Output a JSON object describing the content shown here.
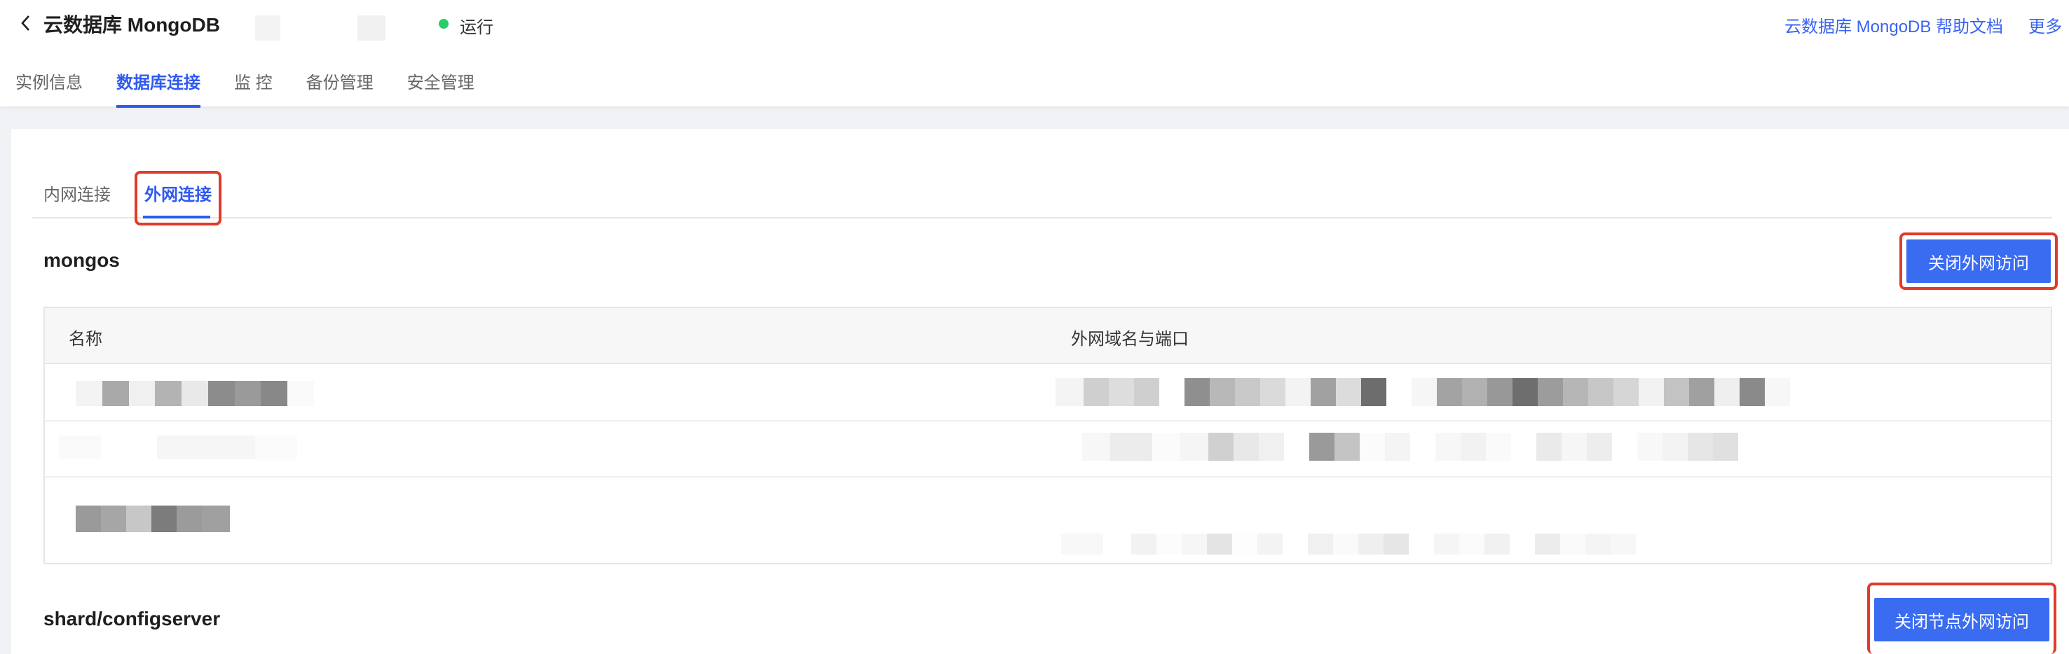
{
  "header": {
    "title": "云数据库 MongoDB",
    "status": "运行",
    "status_color": "#29cc6a",
    "help_link": "云数据库 MongoDB 帮助文档",
    "more_link": "更多",
    "back_icon": "chevron-left-icon"
  },
  "nav": {
    "tabs": [
      {
        "label": "实例信息",
        "active": false
      },
      {
        "label": "数据库连接",
        "active": true
      },
      {
        "label": "监 控",
        "active": false
      },
      {
        "label": "备份管理",
        "active": false
      },
      {
        "label": "安全管理",
        "active": false
      }
    ]
  },
  "connection_tabs": {
    "inner": "内网连接",
    "outer": "外网连接",
    "active": "外网连接"
  },
  "mongos": {
    "title": "mongos",
    "close_button": "关闭外网访问",
    "table": {
      "columns": [
        "名称",
        "外网域名与端口"
      ]
    }
  },
  "shard": {
    "title": "shard/configserver",
    "close_button": "关闭节点外网访问"
  },
  "colors": {
    "accent": "#3a6cf2",
    "highlight": "#e23b2b",
    "link": "#3a63f0"
  }
}
